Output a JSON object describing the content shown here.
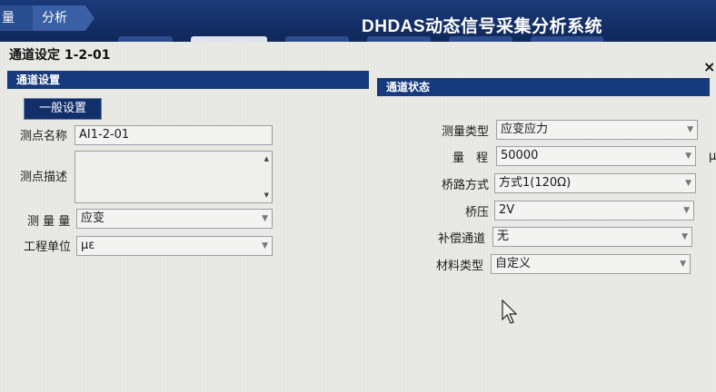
{
  "header": {
    "breadcrumb": [
      "量",
      "分析"
    ],
    "app_title": "DHDAS动态信号采集分析系统"
  },
  "dialog": {
    "title": "通道设定 1-2-01",
    "close_label": "×",
    "left_section_title": "通道设置",
    "right_section_title": "通道状态",
    "general_tab_label": "一般设置",
    "left_fields": {
      "point_name_label": "测点名称",
      "point_name_value": "AI1-2-01",
      "point_desc_label": "测点描述",
      "measure_label": "测 量 量",
      "measure_value": "应变",
      "unit_label": "工程单位",
      "unit_value": "με"
    },
    "right_fields": {
      "measure_type_label": "测量类型",
      "measure_type_value": "应变应力",
      "range_label": "量　程",
      "range_value": "50000",
      "range_unit_partial": "μ",
      "bridge_mode_label": "桥路方式",
      "bridge_mode_value": "方式1(120Ω)",
      "bridge_voltage_label": "桥压",
      "bridge_voltage_value": "2V",
      "compensation_label": "补偿通道",
      "compensation_value": "无",
      "material_label": "材料类型",
      "material_value": "自定义"
    }
  },
  "icons": {
    "dropdown": "chevron-down-icon",
    "scroll_up": "triangle-up-icon",
    "scroll_down": "triangle-down-icon",
    "close": "close-icon",
    "cursor": "mouse-pointer-icon"
  },
  "colors": {
    "header_bg": "#122c62",
    "section_bar": "#163a7d",
    "dialog_bg": "#e9e9e6"
  }
}
